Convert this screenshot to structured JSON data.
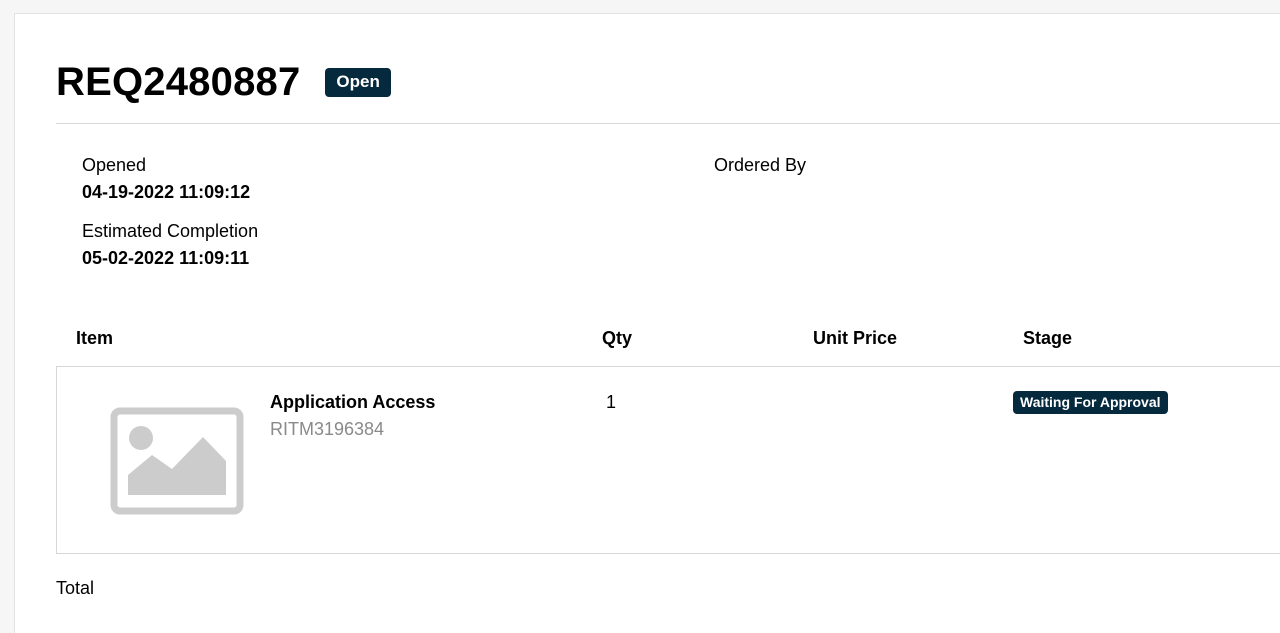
{
  "request": {
    "number": "REQ2480887",
    "status": "Open"
  },
  "details": {
    "opened_label": "Opened",
    "opened_value": "04-19-2022 11:09:12",
    "estimated_label": "Estimated Completion",
    "estimated_value": "05-02-2022 11:09:11",
    "ordered_by_label": "Ordered By"
  },
  "table": {
    "columns": [
      "Item",
      "Qty",
      "Unit Price",
      "Stage"
    ],
    "rows": [
      {
        "image_icon": "image-placeholder-icon",
        "name": "Application Access",
        "number": "RITM3196384",
        "qty": "1",
        "stage": "Waiting For Approval"
      }
    ]
  },
  "footer": {
    "total_label": "Total"
  },
  "colors": {
    "badge_bg": "#062a3d",
    "secondary_text": "#8a8a8a",
    "placeholder_gray": "#cccccc"
  }
}
